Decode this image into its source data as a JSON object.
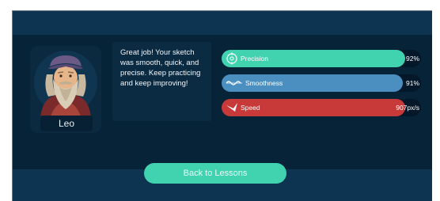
{
  "avatar": {
    "name": "Leo"
  },
  "feedback": {
    "message": "Great job! Your sketch was smooth, quick, and precise. Keep practicing and keep improving!"
  },
  "metrics": [
    {
      "label": "Precision",
      "value": "92%",
      "fill_fraction": 0.92,
      "color": "#41d3b0",
      "icon": "target-icon"
    },
    {
      "label": "Smoothness",
      "value": "91%",
      "fill_fraction": 0.91,
      "color": "#4b8fc0",
      "icon": "wave-line-icon"
    },
    {
      "label": "Speed",
      "value": "907px/s",
      "fill_fraction": 0.92,
      "color": "#c83a3a",
      "icon": "swoosh-icon"
    }
  ],
  "actions": {
    "back_label": "Back to Lessons"
  },
  "colors": {
    "accent": "#41d3b0",
    "background": "#0b2f49",
    "panel": "#062338"
  }
}
